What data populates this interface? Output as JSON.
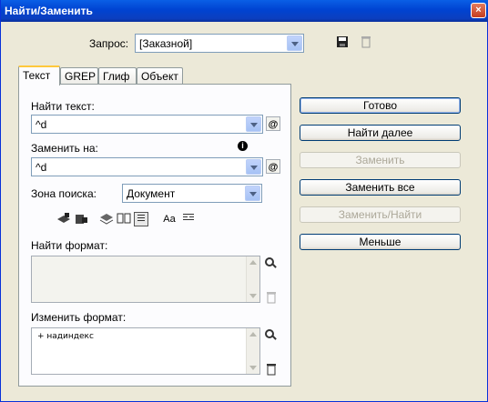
{
  "window": {
    "title": "Найти/Заменить",
    "close_glyph": "×"
  },
  "query": {
    "label": "Запрос:",
    "value": "[Заказной]"
  },
  "tabs": [
    {
      "label": "Текст",
      "active": true
    },
    {
      "label": "GREP",
      "active": false
    },
    {
      "label": "Глиф",
      "active": false
    },
    {
      "label": "Объект",
      "active": false
    }
  ],
  "find": {
    "label": "Найти текст:",
    "value": "^d"
  },
  "replace": {
    "label": "Заменить на:",
    "value": "^d"
  },
  "search_zone": {
    "label": "Зона поиска:",
    "value": "Документ"
  },
  "option_icons": {
    "case_label": "Aa"
  },
  "find_format": {
    "label": "Найти формат:",
    "content": ""
  },
  "change_format": {
    "label": "Изменить формат:",
    "content": "+ надиндекс"
  },
  "buttons": {
    "done": "Готово",
    "find_next": "Найти далее",
    "replace": "Заменить",
    "replace_all": "Заменить все",
    "replace_find": "Заменить/Найти",
    "less": "Меньше"
  },
  "special_char_glyph": "@",
  "info_glyph": "i"
}
